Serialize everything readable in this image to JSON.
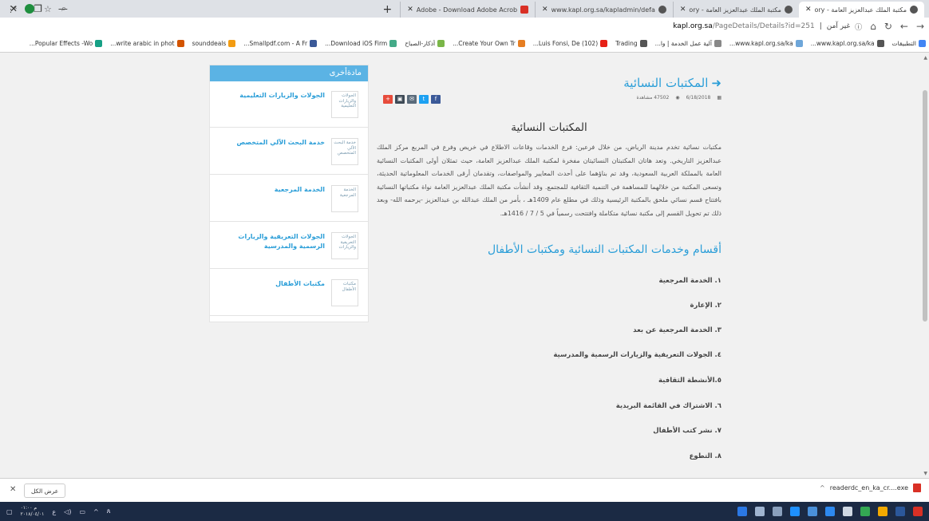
{
  "browser": {
    "tabs": [
      {
        "title": "مكتبة الملك عبدالعزيز العامة - ory",
        "active": true
      },
      {
        "title": "مكتبة الملك عبدالعزيز العامة - ory",
        "active": false
      },
      {
        "title": "www.kapl.org.sa/kapladmin/defa",
        "active": false
      },
      {
        "title": "Adobe - Download Adobe Acrob",
        "active": false
      }
    ],
    "url_domain": "kapl.org.sa",
    "url_path": "/PageDetails/Details?id=251",
    "security_label": "غير آمن",
    "bookmarks": [
      "التطبيقات",
      "www.kapl.org.sa/ka...",
      "www.kapl.org.sa/ka...",
      "آلية عمل الخدمة | وا...",
      "Trading",
      "(102) Luis Fonsi, De...",
      "Create Your Own Tr...",
      "أذكار-الصباح",
      "Download iOS Firm...",
      "Smallpdf.com - A Fr...",
      "sounddeals",
      "write arabic in phot...",
      "Popular Effects -Wo..."
    ]
  },
  "article": {
    "title": "المكتبات النسائية",
    "date": "6/18/2018",
    "views": "47502 مشاهدة",
    "heading": "المكتبات النسائية",
    "intro": "مكتبات نسائية تخدم مدينة الرياض، من خلال فرعين: فرع الخدمات وقاعات الاطلاع في خريص وفرع في المربع مركز الملك عبدالعزيز التاريخي. وتعد هاتان المكتبتان النسائيتان مفخرة لمكتبة الملك عبدالعزيز العامة، حيث تمثلان أولى المكتبات النسائية العامة بالمملكة العربية السعودية، وقد تم بناؤهما على أحدث المعايير والمواصفات، وتقدمان أرقى الخدمات المعلوماتية الحديثة، وتسعى المكتبة من خلالهما للمساهمة في التنمية الثقافية للمجتمع. وقد أنشأت مكتبة الملك عبدالعزيز العامة نواة مكتباتها النسائية بافتتاح قسم نسائي ملحق بالمكتبة الرئيسية وذلك في مطلع عام 1409هـ ، بأمر من الملك عبدالله بن عبدالعزيز -يرحمه الله- وبعد ذلك تم تحويل القسم إلى مكتبة نسائية متكاملة وافتتحت رسمياً في 5 / 7 / 1416هـ.",
    "sections_heading": "أقسام وخدمات المكتبات النسائية ومكتبات الأطفال",
    "services": [
      "١. الخدمة المرجعية",
      "٢. الإعارة",
      "٣. الخدمة المرجعية عن بعد",
      "٤. الجولات التعريفية والزيارات الرسمية والمدرسية",
      "٥.الأنشطة الثقافية",
      "٦. الاشتراك في القائمة البريدية",
      "٧. نشر كتب الأطفال",
      "٨. التطوع"
    ]
  },
  "sidebar": {
    "header": "مادةأخرى",
    "items": [
      {
        "title": "الجولات والزيارات التعليمية",
        "thumb_alt": "الجولات والزيارات التعليمية"
      },
      {
        "title": "خدمة البحث الآلي المتخصص",
        "thumb_alt": "خدمة البحث الآلي المتخصص"
      },
      {
        "title": "الخدمة المرجعية",
        "thumb_alt": "الخدمة المرجعية"
      },
      {
        "title": "الجولات التعريفية والزيارات الرسمية والمدرسية",
        "thumb_alt": "الجولات التعريفية والزيارات"
      },
      {
        "title": "مكتبات الأطفال",
        "thumb_alt": "مكتبات الأطفال"
      }
    ]
  },
  "downloads": {
    "show_all": "عرض الكل",
    "file": "readerdc_en_ka_cr....exe"
  },
  "taskbar": {
    "time": "م ٠١:٠٠",
    "date": "٢٠١٨/٠٤/٠١"
  }
}
